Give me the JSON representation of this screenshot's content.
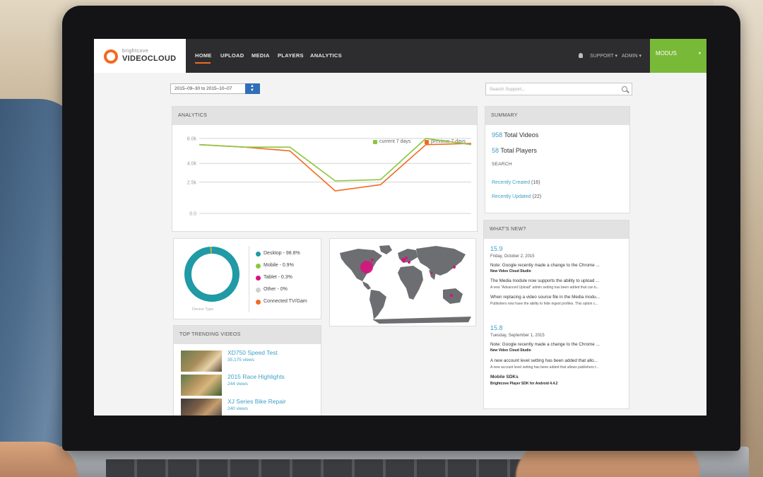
{
  "brand": {
    "small": "brightcove",
    "main": "VIDEOCLOUD"
  },
  "nav": {
    "items": [
      {
        "label": "HOME"
      },
      {
        "label": "UPLOAD"
      },
      {
        "label": "MEDIA"
      },
      {
        "label": "PLAYERS"
      },
      {
        "label": "ANALYTICS"
      }
    ],
    "support": "SUPPORT ▾",
    "admin": "ADMIN ▾",
    "account": "MODUS",
    "account_caret": "▾"
  },
  "date_range": "2015–09–30 to 2015–10–07",
  "search": {
    "placeholder": "Search Support..."
  },
  "analytics": {
    "title": "ANALYTICS",
    "chart_data": {
      "type": "line",
      "x": [
        1,
        2,
        3,
        4,
        5,
        6,
        7
      ],
      "series": [
        {
          "name": "current 7 days",
          "color": "#8cc63f",
          "values": [
            5.5,
            5.3,
            5.3,
            2.6,
            2.7,
            6.0,
            5.5
          ]
        },
        {
          "name": "previous 7 days",
          "color": "#f26a21",
          "values": [
            5.5,
            5.3,
            5.0,
            1.8,
            2.3,
            5.5,
            5.6
          ]
        }
      ],
      "y_ticks": [
        "6.0k",
        "4.0k",
        "2.5k",
        "0.0"
      ],
      "ylim": [
        0,
        6.5
      ],
      "grid": true,
      "legend_position": "top-right"
    }
  },
  "summary": {
    "title": "SUMMARY",
    "videos_count": "958",
    "videos_label": "Total Videos",
    "players_count": "58",
    "players_label": "Total Players",
    "search_label": "SEARCH",
    "links": [
      {
        "label": "Recently Created",
        "count": "(16)"
      },
      {
        "label": "Recently Updated",
        "count": "(22)"
      }
    ]
  },
  "devices": {
    "caption": "Device Type",
    "items": [
      {
        "label": "Desktop - 98.8%",
        "color": "#1f9aa6",
        "share": 98.8
      },
      {
        "label": "Mobile - 0.9%",
        "color": "#8cc63f",
        "share": 0.9
      },
      {
        "label": "Tablet - 0.3%",
        "color": "#d8127f",
        "share": 0.3
      },
      {
        "label": "Other - 0%",
        "color": "#cfcfcf",
        "share": 0
      },
      {
        "label": "Connected TV/Gam",
        "color": "#f26a21",
        "share": 0
      }
    ]
  },
  "trending": {
    "title": "TOP TRENDING VIDEOS",
    "videos": [
      {
        "title": "XD750 Speed Test",
        "views": "35,175 views"
      },
      {
        "title": "2015 Race Highlights",
        "views": "244 views"
      },
      {
        "title": "XJ Series Bike Repair",
        "views": "240 views"
      }
    ]
  },
  "whats_new": {
    "title": "WHAT'S NEW?",
    "releases": [
      {
        "version": "15.9",
        "date": "Friday, October 2, 2015",
        "entries": [
          {
            "note": "Note: Google recently made a change to the Chrome ...",
            "sub": "New Video Cloud Studio"
          },
          {
            "note": "The Media module now supports the ability to upload ...",
            "small": "A new \"Advanced Upload\" admin setting has been added that can b..."
          },
          {
            "note": "When replacing a video source file in the Media modu...",
            "small": "Publishers now have the ability to hide ingest profiles. This option c..."
          }
        ]
      },
      {
        "version": "15.8",
        "date": "Tuesday, September 1, 2015",
        "entries": [
          {
            "note": "Note: Google recently made a change to the Chrome ...",
            "sub": "New Video Cloud Studio"
          },
          {
            "note": "A new account level setting has been added that allo...",
            "small": "A new account level setting has been added that allows publishers t..."
          }
        ]
      }
    ],
    "sdk_heading": "Mobile SDKs",
    "sdk_sub": "Brightcove Player SDK for Android 4.4.2"
  }
}
